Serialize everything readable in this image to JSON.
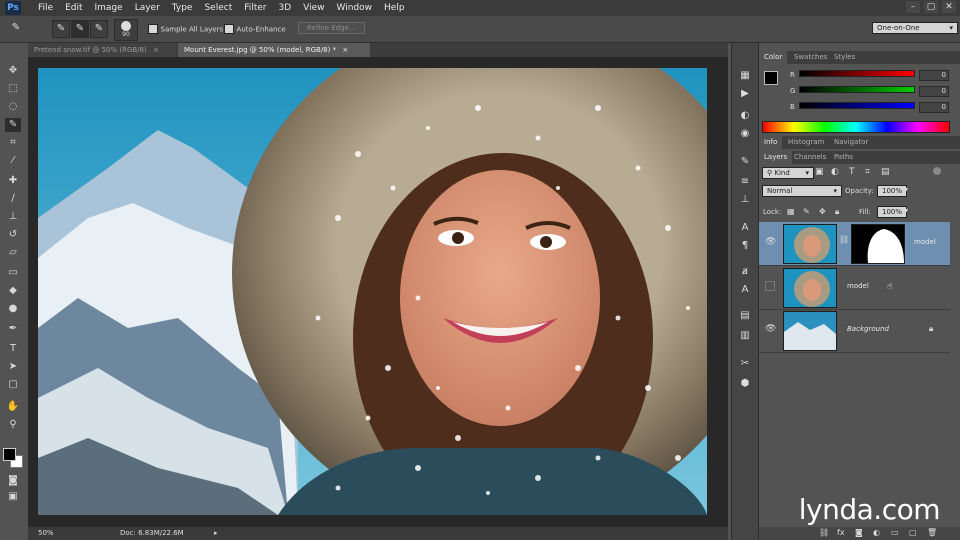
{
  "app": {
    "logo": "Ps"
  },
  "menubar": {
    "items": [
      "File",
      "Edit",
      "Image",
      "Layer",
      "Type",
      "Select",
      "Filter",
      "3D",
      "View",
      "Window",
      "Help"
    ]
  },
  "window_buttons": [
    "–",
    "▢",
    "✕"
  ],
  "optionsbar": {
    "brush_size": "90",
    "sample_all_layers": "Sample All Layers",
    "auto_enhance": "Auto-Enhance",
    "refine_edge": "Refine Edge...",
    "workspace": "One-on-One"
  },
  "tabs": [
    {
      "label": "Pretend snow.tif @ 50% (RGB/8)",
      "active": false
    },
    {
      "label": "Mount Everest.jpg @ 50% (model, RGB/8) *",
      "active": true
    }
  ],
  "status": {
    "zoom": "50%",
    "doc": "Doc: 6.83M/22.6M"
  },
  "color_panel": {
    "tabs": [
      "Color",
      "Swatches",
      "Styles"
    ],
    "r": {
      "label": "R",
      "value": "0"
    },
    "g": {
      "label": "G",
      "value": "0"
    },
    "b": {
      "label": "B",
      "value": "0"
    }
  },
  "info_panel": {
    "tabs": [
      "Info",
      "Histogram",
      "Navigator"
    ]
  },
  "layers_panel": {
    "tabs": [
      "Layers",
      "Channels",
      "Paths"
    ],
    "kind": "Kind",
    "blend_mode": "Normal",
    "opacity_label": "Opacity:",
    "opacity": "100%",
    "lock_label": "Lock:",
    "fill_label": "Fill:",
    "fill": "100%",
    "layers": [
      {
        "name": "model",
        "visible": true,
        "has_mask": true,
        "selected": true
      },
      {
        "name": "model",
        "visible": false,
        "has_mask": false,
        "selected": false
      },
      {
        "name": "Background",
        "visible": true,
        "has_mask": false,
        "selected": false
      }
    ]
  },
  "watermark": "lynda.com",
  "colors": {
    "accent": "#6e8fb0",
    "panel": "#535353",
    "dark": "#3b3b3b"
  }
}
